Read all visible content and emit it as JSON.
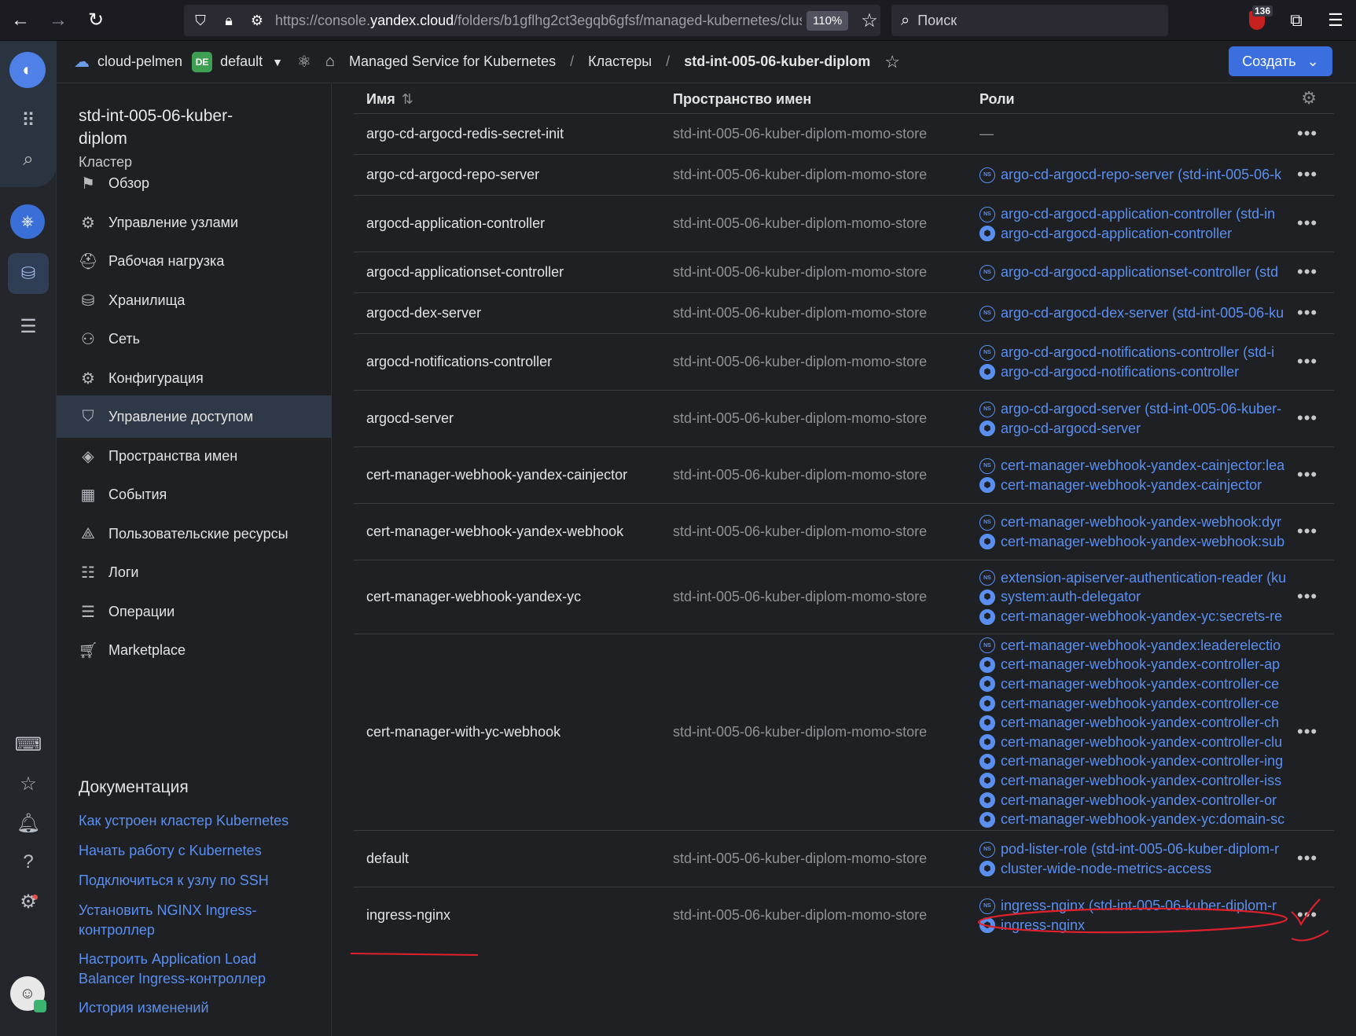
{
  "browser": {
    "url_prefix": "https://console.",
    "url_domain": "yandex.cloud",
    "url_rest": "/folders/b1gflhg2ct3egqb6gfsf/managed-kubernetes/clust",
    "zoom": "110%",
    "search_placeholder": "Поиск",
    "extension_badge": "136"
  },
  "header": {
    "cloud": "cloud-pelmen",
    "folder_badge": "DE",
    "folder": "default",
    "breadcrumbs": [
      "Managed Service for Kubernetes",
      "Кластеры",
      "std-int-005-06-kuber-diplom"
    ],
    "create_label": "Создать"
  },
  "sidebar": {
    "title": "std-int-005-06-kuber-diplom",
    "subtitle": "Кластер",
    "items": [
      {
        "label": "Обзор",
        "icon": "flag-icon"
      },
      {
        "label": "Управление узлами",
        "icon": "nodes-icon"
      },
      {
        "label": "Рабочая нагрузка",
        "icon": "workload-icon"
      },
      {
        "label": "Хранилища",
        "icon": "database-icon"
      },
      {
        "label": "Сеть",
        "icon": "network-icon"
      },
      {
        "label": "Конфигурация",
        "icon": "gear-icon"
      },
      {
        "label": "Управление доступом",
        "icon": "shield-icon"
      },
      {
        "label": "Пространства имен",
        "icon": "layers-icon"
      },
      {
        "label": "События",
        "icon": "calendar-icon"
      },
      {
        "label": "Пользовательские ресурсы",
        "icon": "shapes-icon"
      },
      {
        "label": "Логи",
        "icon": "logs-icon"
      },
      {
        "label": "Операции",
        "icon": "list-icon"
      },
      {
        "label": "Marketplace",
        "icon": "cart-icon"
      }
    ],
    "docs_title": "Документация",
    "docs": [
      "Как устроен кластер Kubernetes",
      "Начать работу с Kubernetes",
      "Подключиться к узлу по SSH",
      "Установить NGINX Ingress-контроллер",
      "Настроить Application Load Balancer Ingress-контроллер",
      "История изменений"
    ]
  },
  "table": {
    "columns": [
      "Имя",
      "Пространство имен",
      "Роли"
    ],
    "rows": [
      {
        "name": "argo-cd-argocd-redis-secret-init",
        "ns": "std-int-005-06-kuber-diplom-momo-store",
        "roles": []
      },
      {
        "name": "argo-cd-argocd-repo-server",
        "ns": "std-int-005-06-kuber-diplom-momo-store",
        "roles": [
          {
            "t": "ns",
            "text": "argo-cd-argocd-repo-server (std-int-005-06-k"
          }
        ]
      },
      {
        "name": "argocd-application-controller",
        "ns": "std-int-005-06-kuber-diplom-momo-store",
        "roles": [
          {
            "t": "ns",
            "text": "argo-cd-argocd-application-controller (std-in"
          },
          {
            "t": "cl",
            "text": "argo-cd-argocd-application-controller"
          }
        ]
      },
      {
        "name": "argocd-applicationset-controller",
        "ns": "std-int-005-06-kuber-diplom-momo-store",
        "roles": [
          {
            "t": "ns",
            "text": "argo-cd-argocd-applicationset-controller (std"
          }
        ]
      },
      {
        "name": "argocd-dex-server",
        "ns": "std-int-005-06-kuber-diplom-momo-store",
        "roles": [
          {
            "t": "ns",
            "text": "argo-cd-argocd-dex-server (std-int-005-06-ku"
          }
        ]
      },
      {
        "name": "argocd-notifications-controller",
        "ns": "std-int-005-06-kuber-diplom-momo-store",
        "roles": [
          {
            "t": "ns",
            "text": "argo-cd-argocd-notifications-controller (std-i"
          },
          {
            "t": "cl",
            "text": "argo-cd-argocd-notifications-controller"
          }
        ]
      },
      {
        "name": "argocd-server",
        "ns": "std-int-005-06-kuber-diplom-momo-store",
        "roles": [
          {
            "t": "ns",
            "text": "argo-cd-argocd-server (std-int-005-06-kuber-"
          },
          {
            "t": "cl",
            "text": "argo-cd-argocd-server"
          }
        ]
      },
      {
        "name": "cert-manager-webhook-yandex-cainjector",
        "ns": "std-int-005-06-kuber-diplom-momo-store",
        "roles": [
          {
            "t": "ns",
            "text": "cert-manager-webhook-yandex-cainjector:lea"
          },
          {
            "t": "cl",
            "text": "cert-manager-webhook-yandex-cainjector"
          }
        ]
      },
      {
        "name": "cert-manager-webhook-yandex-webhook",
        "ns": "std-int-005-06-kuber-diplom-momo-store",
        "roles": [
          {
            "t": "ns",
            "text": "cert-manager-webhook-yandex-webhook:dyr"
          },
          {
            "t": "cl",
            "text": "cert-manager-webhook-yandex-webhook:sub"
          }
        ]
      },
      {
        "name": "cert-manager-webhook-yandex-yc",
        "ns": "std-int-005-06-kuber-diplom-momo-store",
        "roles": [
          {
            "t": "ns",
            "text": "extension-apiserver-authentication-reader (ku"
          },
          {
            "t": "cl",
            "text": "system:auth-delegator"
          },
          {
            "t": "cl",
            "text": "cert-manager-webhook-yandex-yc:secrets-re"
          }
        ]
      },
      {
        "name": "cert-manager-with-yc-webhook",
        "ns": "std-int-005-06-kuber-diplom-momo-store",
        "roles": [
          {
            "t": "ns",
            "text": "cert-manager-webhook-yandex:leaderelectio"
          },
          {
            "t": "cl",
            "text": "cert-manager-webhook-yandex-controller-ap"
          },
          {
            "t": "cl",
            "text": "cert-manager-webhook-yandex-controller-ce"
          },
          {
            "t": "cl",
            "text": "cert-manager-webhook-yandex-controller-ce"
          },
          {
            "t": "cl",
            "text": "cert-manager-webhook-yandex-controller-ch"
          },
          {
            "t": "cl",
            "text": "cert-manager-webhook-yandex-controller-clu"
          },
          {
            "t": "cl",
            "text": "cert-manager-webhook-yandex-controller-ing"
          },
          {
            "t": "cl",
            "text": "cert-manager-webhook-yandex-controller-iss"
          },
          {
            "t": "cl",
            "text": "cert-manager-webhook-yandex-controller-or"
          },
          {
            "t": "cl",
            "text": "cert-manager-webhook-yandex-yc:domain-sc"
          }
        ]
      },
      {
        "name": "default",
        "ns": "std-int-005-06-kuber-diplom-momo-store",
        "roles": [
          {
            "t": "ns",
            "text": "pod-lister-role (std-int-005-06-kuber-diplom-r"
          },
          {
            "t": "cl",
            "text": "cluster-wide-node-metrics-access"
          }
        ]
      },
      {
        "name": "ingress-nginx",
        "ns": "std-int-005-06-kuber-diplom-momo-store",
        "roles": [
          {
            "t": "ns",
            "text": "ingress-nginx (std-int-005-06-kuber-diplom-r"
          },
          {
            "t": "cl",
            "text": "ingress-nginx"
          }
        ]
      }
    ],
    "empty_role": "—",
    "row_menu": "•••",
    "ns_badge": "NS",
    "cluster_role_glyph": "⬢"
  },
  "colors": {
    "accent": "#3b6fe0",
    "link": "#5a8ff0",
    "annotation": "#e0202a"
  }
}
